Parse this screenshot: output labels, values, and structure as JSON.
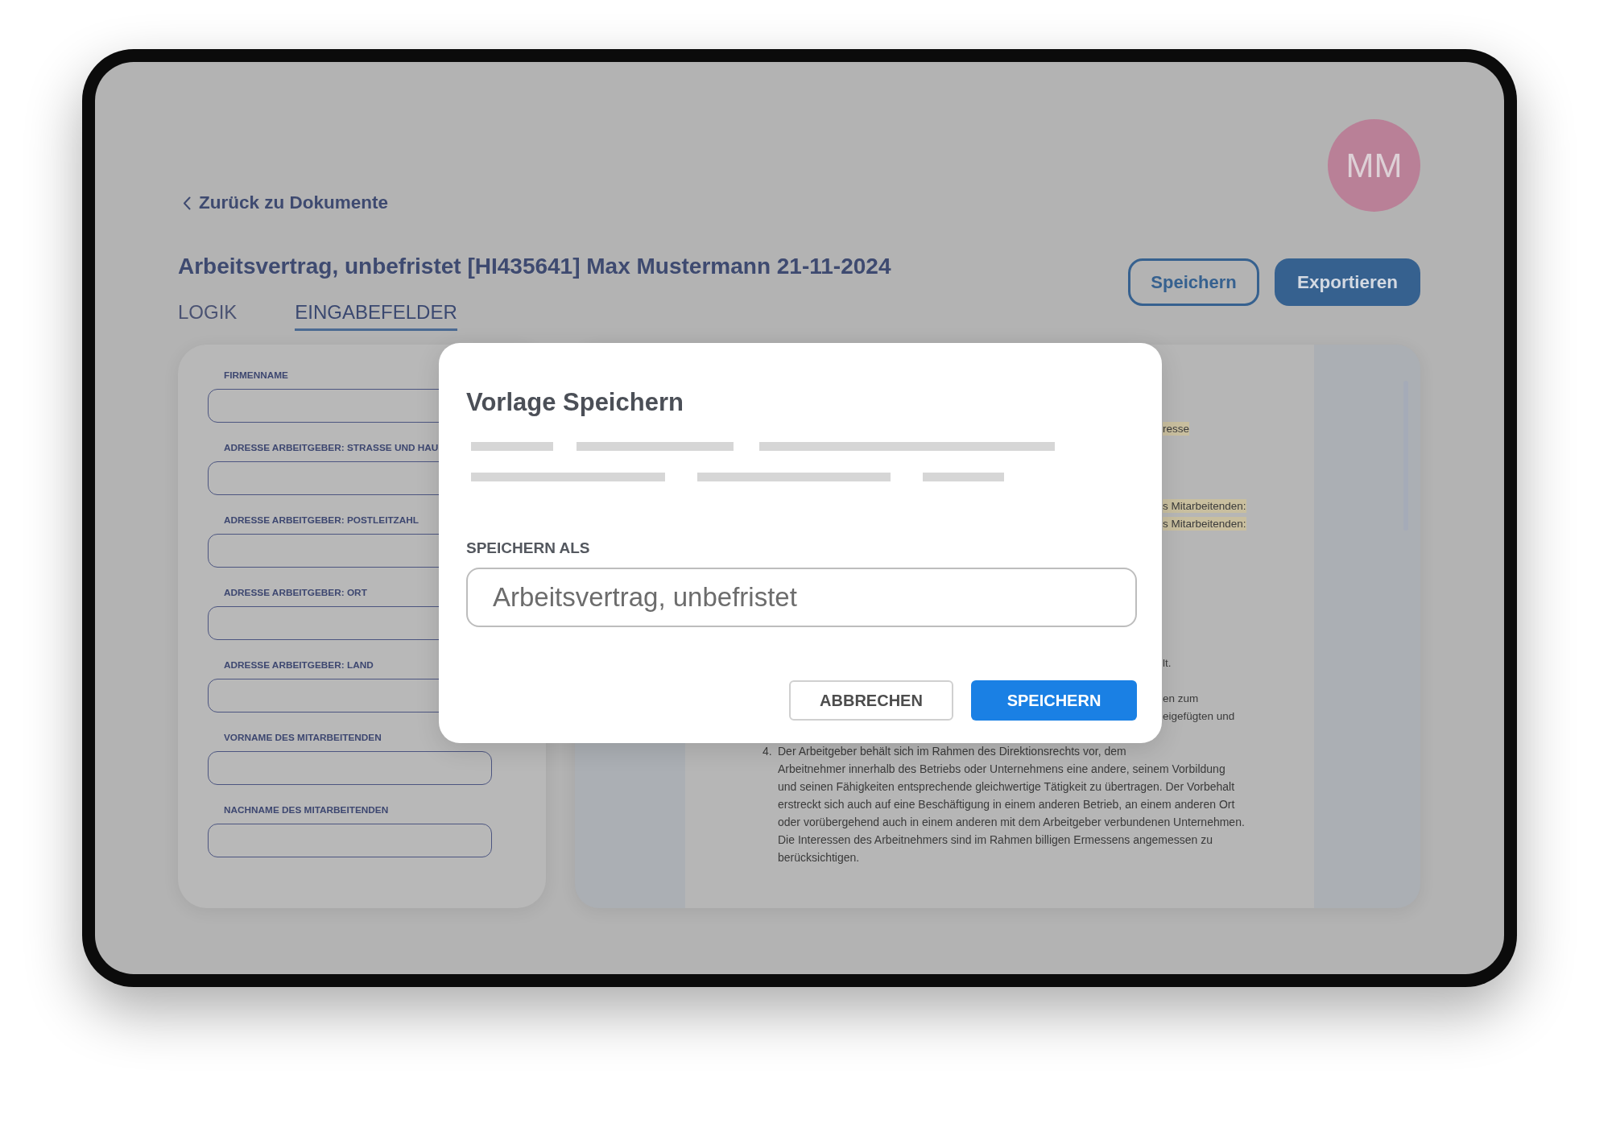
{
  "back_link": {
    "label": "Zurück zu Dokumente"
  },
  "avatar": {
    "initials": "MM"
  },
  "document_title": "Arbeitsvertrag, unbefristet [HI435641] Max Mustermann 21-11-2024",
  "tabs": [
    {
      "label": "LOGIK",
      "selected": false
    },
    {
      "label": "EINGABEFELDER",
      "selected": true
    }
  ],
  "actions": [
    {
      "label": "Speichern",
      "kind": "outline"
    },
    {
      "label": "Exportieren",
      "kind": "filled"
    }
  ],
  "input_fields": [
    {
      "label": "FIRMENNAME"
    },
    {
      "label": "ADRESSE ARBEITGEBER: STRASSE UND HAU"
    },
    {
      "label": "ADRESSE ARBEITGEBER: POSTLEITZAHL"
    },
    {
      "label": "ADRESSE ARBEITGEBER: ORT"
    },
    {
      "label": "ADRESSE ARBEITGEBER: LAND"
    },
    {
      "label": "VORNAME DES MITARBEITENDEN"
    },
    {
      "label": "NACHNAME DES MITARBEITENDEN"
    }
  ],
  "document_preview": {
    "fragment_groups": [
      {
        "lines": [
          {
            "text": "resse",
            "highlighted": true
          }
        ]
      },
      {
        "lines": [
          {
            "text": "s Mitarbeitenden:",
            "highlighted": true
          },
          {
            "text": "s Mitarbeitenden:",
            "highlighted": true
          }
        ]
      },
      {
        "lines": [
          {
            "text": "lt.",
            "highlighted": false
          }
        ]
      },
      {
        "lines": [
          {
            "text": "en zum",
            "highlighted": false
          },
          {
            "text": "eigefügten und",
            "highlighted": false
          }
        ]
      }
    ],
    "list_item": {
      "number": "4.",
      "text": "Der Arbeitgeber behält sich im Rahmen des Direktionsrechts vor, dem\nArbeitnehmer innerhalb des Betriebs oder Unternehmens eine andere, seinem Vorbildung\nund seinen Fähigkeiten entsprechende gleichwertige Tätigkeit zu übertragen. Der Vorbehalt\nerstreckt sich auch auf eine Beschäftigung in einem anderen Betrieb, an einem anderen Ort\noder vorübergehend auch in einem anderen mit dem Arbeitgeber verbundenen Unternehmen.\nDie Interessen des Arbeitnehmers sind im Rahmen billigen Ermessens angemessen zu\nberücksichtigen."
    }
  },
  "dialog": {
    "title": "Vorlage Speichern",
    "field": {
      "label": "SPEICHERN ALS",
      "value": "Arbeitsvertrag, unbefristet"
    },
    "buttons": [
      {
        "label": "ABBRECHEN",
        "kind": "secondary"
      },
      {
        "label": "SPEICHERN",
        "kind": "primary"
      }
    ]
  }
}
